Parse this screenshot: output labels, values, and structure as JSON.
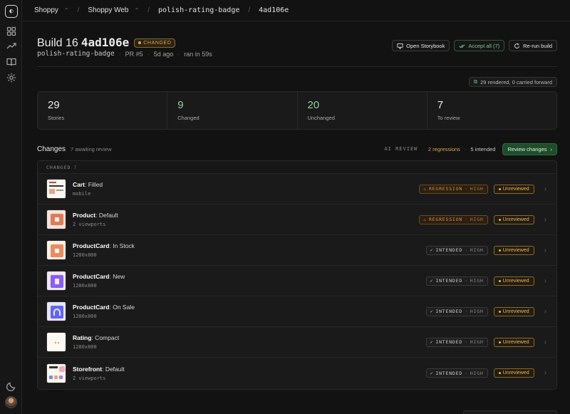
{
  "breadcrumb": {
    "org": "Shoppy",
    "project": "Shoppy Web",
    "branch": "polish-rating-badge",
    "commit": "4ad106e"
  },
  "build": {
    "title": "Build 16",
    "hash": "4ad106e",
    "status": "CHANGED",
    "branch": "polish-rating-badge",
    "pr": "PR #5",
    "age": "5d ago",
    "duration": "ran in 59s"
  },
  "actions": {
    "open_storybook": "Open Storybook",
    "accept_all": "Accept all (7)",
    "rerun": "Re-run build"
  },
  "rendered_note": "29 rendered, 0 carried forward",
  "stats": [
    {
      "value": "29",
      "label": "Stories"
    },
    {
      "value": "9",
      "label": "Changed"
    },
    {
      "value": "20",
      "label": "Unchanged"
    },
    {
      "value": "7",
      "label": "To review"
    }
  ],
  "changes": {
    "title": "Changes",
    "awaiting": "7 awaiting review",
    "ai_label": "AI REVIEW",
    "regressions": "2 regressions",
    "intended": "5 intended",
    "review_btn": "Review changes",
    "group_label": "CHANGED",
    "group_count": "7"
  },
  "rows": [
    {
      "component": "Cart",
      "story": ": Filled",
      "sub": "mobile",
      "verdict": "REGRESSION",
      "severity": "HIGH",
      "status": "Unreviewed",
      "thumb": "cart"
    },
    {
      "component": "Product",
      "story": ": Default",
      "sub": "2 viewports",
      "verdict": "REGRESSION",
      "severity": "HIGH",
      "status": "Unreviewed",
      "thumb": "product"
    },
    {
      "component": "ProductCard",
      "story": ": In Stock",
      "sub": "1280x800",
      "verdict": "INTENDED",
      "severity": "HIGH",
      "status": "Unreviewed",
      "thumb": "instock"
    },
    {
      "component": "ProductCard",
      "story": ": New",
      "sub": "1280x800",
      "verdict": "INTENDED",
      "severity": "HIGH",
      "status": "Unreviewed",
      "thumb": "new"
    },
    {
      "component": "ProductCard",
      "story": ": On Sale",
      "sub": "1280x800",
      "verdict": "INTENDED",
      "severity": "HIGH",
      "status": "Unreviewed",
      "thumb": "onsale"
    },
    {
      "component": "Rating",
      "story": ": Compact",
      "sub": "1280x800",
      "verdict": "INTENDED",
      "severity": "HIGH",
      "status": "Unreviewed",
      "thumb": "rating"
    },
    {
      "component": "Storefront",
      "story": ": Default",
      "sub": "2 viewports",
      "verdict": "INTENDED",
      "severity": "HIGH",
      "status": "Unreviewed",
      "thumb": "storefront"
    }
  ]
}
